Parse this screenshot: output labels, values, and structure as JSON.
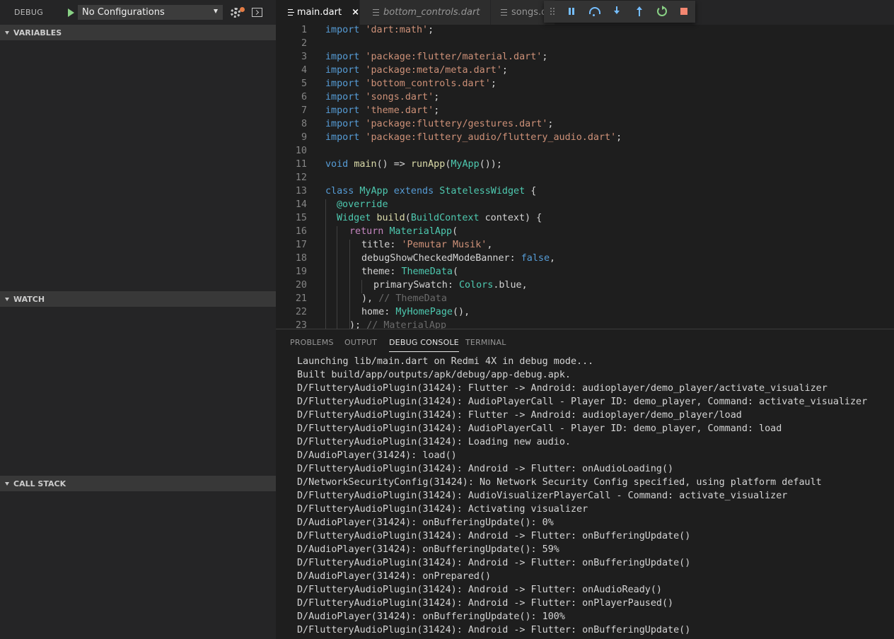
{
  "sidebar": {
    "title": "DEBUG",
    "config_value": "No Configurations",
    "sections": {
      "variables": "VARIABLES",
      "watch": "WATCH",
      "call_stack": "CALL STACK"
    }
  },
  "editor": {
    "tabs": [
      {
        "label": "main.dart",
        "active": true
      },
      {
        "label": "bottom_controls.dart",
        "active": false
      },
      {
        "label": "songs.d",
        "active": false
      }
    ],
    "close_glyph": "×",
    "line_numbers": [
      "1",
      "2",
      "3",
      "4",
      "5",
      "6",
      "7",
      "8",
      "9",
      "10",
      "11",
      "12",
      "13",
      "14",
      "15",
      "16",
      "17",
      "18",
      "19",
      "20",
      "21",
      "22",
      "23"
    ]
  },
  "debug_toolbar": {
    "buttons": [
      "drag-handle-icon",
      "pause-icon",
      "step-over-icon",
      "step-into-icon",
      "step-out-icon",
      "restart-icon",
      "stop-icon"
    ]
  },
  "code": {
    "l1": {
      "kw": "import",
      "str": "'dart:math'",
      "end": ";"
    },
    "l3": {
      "kw": "import",
      "str": "'package:flutter/material.dart'",
      "end": ";"
    },
    "l4": {
      "kw": "import",
      "str": "'package:meta/meta.dart'",
      "end": ";"
    },
    "l5": {
      "kw": "import",
      "str": "'bottom_controls.dart'",
      "end": ";"
    },
    "l6": {
      "kw": "import",
      "str": "'songs.dart'",
      "end": ";"
    },
    "l7": {
      "kw": "import",
      "str": "'theme.dart'",
      "end": ";"
    },
    "l8": {
      "kw": "import",
      "str": "'package:fluttery/gestures.dart'",
      "end": ";"
    },
    "l9": {
      "kw": "import",
      "str": "'package:fluttery_audio/fluttery_audio.dart'",
      "end": ";"
    },
    "l11": {
      "kw": "void",
      "fn": "main",
      "p1": "() => ",
      "fn2": "runApp",
      "p2": "(",
      "ty": "MyApp",
      "p3": "());"
    },
    "l13": {
      "kw": "class",
      "ty1": "MyApp",
      "kw2": "extends",
      "ty2": "StatelessWidget",
      "p": " {"
    },
    "l14": {
      "ann": "@override"
    },
    "l15": {
      "ty": "Widget",
      "fn": "build",
      "p1": "(",
      "ty2": "BuildContext",
      "p2": " context) {"
    },
    "l16": {
      "kw": "return",
      "ty": "MaterialApp",
      "p": "("
    },
    "l17": {
      "prop": "title",
      "p1": ": ",
      "str": "'Pemutar Musik'",
      "p2": ","
    },
    "l18": {
      "prop": "debugShowCheckedModeBanner",
      "p1": ": ",
      "kw": "false",
      "p2": ","
    },
    "l19": {
      "prop": "theme",
      "p1": ": ",
      "ty": "ThemeData",
      "p2": "("
    },
    "l20": {
      "prop": "primarySwatch",
      "p1": ": ",
      "ty": "Colors",
      "p2": ".blue,"
    },
    "l21": {
      "p": "), ",
      "cm": "// ThemeData"
    },
    "l22": {
      "prop": "home",
      "p1": ": ",
      "ty": "MyHomePage",
      "p2": "(),"
    },
    "l23": {
      "p": "); ",
      "cm": "// MaterialApp"
    }
  },
  "panel": {
    "tabs": [
      "PROBLEMS",
      "OUTPUT",
      "DEBUG CONSOLE",
      "TERMINAL"
    ],
    "active_tab": "DEBUG CONSOLE",
    "console_lines": [
      "Launching lib/main.dart on Redmi 4X in debug mode...",
      "Built build/app/outputs/apk/debug/app-debug.apk.",
      "D/FlutteryAudioPlugin(31424): Flutter -> Android: audioplayer/demo_player/activate_visualizer",
      "D/FlutteryAudioPlugin(31424): AudioPlayerCall - Player ID: demo_player, Command: activate_visualizer",
      "D/FlutteryAudioPlugin(31424): Flutter -> Android: audioplayer/demo_player/load",
      "D/FlutteryAudioPlugin(31424): AudioPlayerCall - Player ID: demo_player, Command: load",
      "D/FlutteryAudioPlugin(31424): Loading new audio.",
      "D/AudioPlayer(31424): load()",
      "D/FlutteryAudioPlugin(31424): Android -> Flutter: onAudioLoading()",
      "D/NetworkSecurityConfig(31424): No Network Security Config specified, using platform default",
      "D/FlutteryAudioPlugin(31424): AudioVisualizerPlayerCall - Command: activate_visualizer",
      "D/FlutteryAudioPlugin(31424): Activating visualizer",
      "D/AudioPlayer(31424): onBufferingUpdate(): 0%",
      "D/FlutteryAudioPlugin(31424): Android -> Flutter: onBufferingUpdate()",
      "D/AudioPlayer(31424): onBufferingUpdate(): 59%",
      "D/FlutteryAudioPlugin(31424): Android -> Flutter: onBufferingUpdate()",
      "D/AudioPlayer(31424): onPrepared()",
      "D/FlutteryAudioPlugin(31424): Android -> Flutter: onAudioReady()",
      "D/FlutteryAudioPlugin(31424): Android -> Flutter: onPlayerPaused()",
      "D/AudioPlayer(31424): onBufferingUpdate(): 100%",
      "D/FlutteryAudioPlugin(31424): Android -> Flutter: onBufferingUpdate()"
    ]
  },
  "colors": {
    "keyword": "#569cd6",
    "string": "#ce9178",
    "type": "#4ec9b0",
    "function": "#dcdcaa",
    "comment": "#6a9955",
    "pause": "#75beff",
    "restart": "#89d185",
    "stop": "#f48771"
  }
}
